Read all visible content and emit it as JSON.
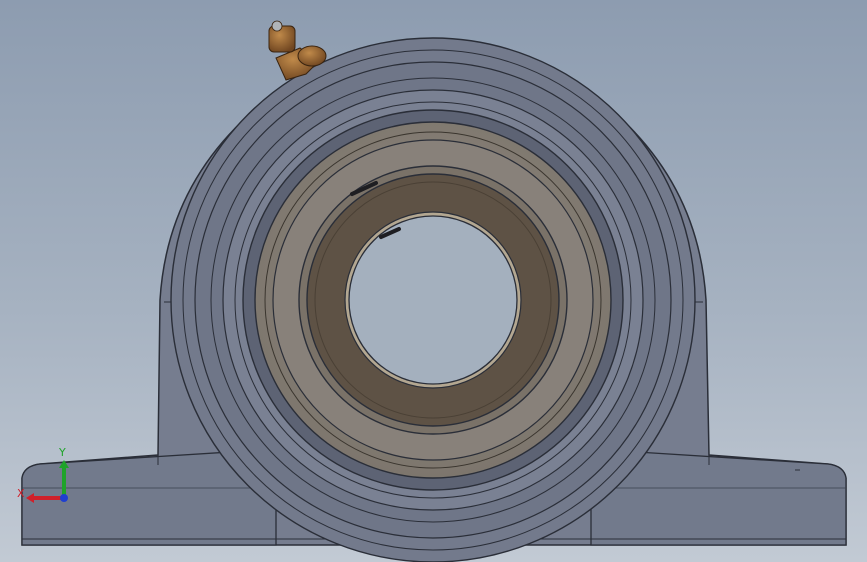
{
  "viewport": {
    "model": "pillow-block-bearing",
    "view": "front",
    "colors": {
      "background_top": "#8d9cb0",
      "background_bottom": "#c2cad4",
      "housing": "#767d8f",
      "housing_dark": "#5d6374",
      "edge": "#2a2e38",
      "bearing_outer": "#8a8076",
      "inner_ring": "#5e5245",
      "grease_fitting": "#8a5a2a"
    }
  },
  "triad": {
    "x_label": "X",
    "y_label": "Y",
    "x_color": "#d0202a",
    "y_color": "#1fa32a",
    "z_color": "#1f3fd0"
  }
}
